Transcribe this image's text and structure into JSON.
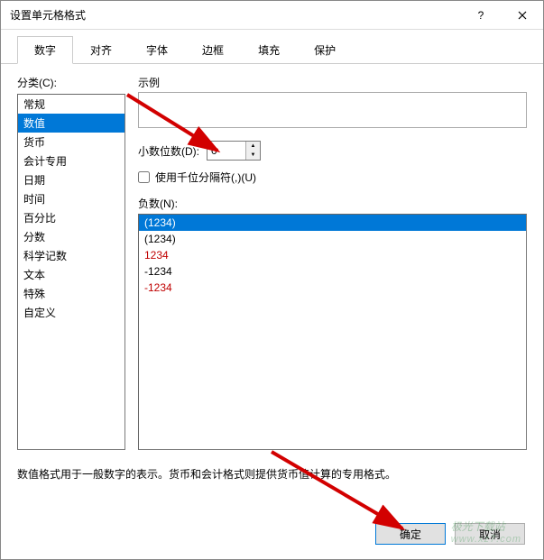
{
  "window": {
    "title": "设置单元格格式"
  },
  "tabs": [
    {
      "label": "数字",
      "active": true
    },
    {
      "label": "对齐",
      "active": false
    },
    {
      "label": "字体",
      "active": false
    },
    {
      "label": "边框",
      "active": false
    },
    {
      "label": "填充",
      "active": false
    },
    {
      "label": "保护",
      "active": false
    }
  ],
  "category": {
    "label": "分类(C):",
    "items": [
      "常规",
      "数值",
      "货币",
      "会计专用",
      "日期",
      "时间",
      "百分比",
      "分数",
      "科学记数",
      "文本",
      "特殊",
      "自定义"
    ],
    "selected_index": 1
  },
  "sample": {
    "label": "示例"
  },
  "decimals": {
    "label": "小数位数(D):",
    "value": "0"
  },
  "separator": {
    "label": "使用千位分隔符(,)(U)",
    "checked": false
  },
  "negative": {
    "label": "负数(N):",
    "items": [
      {
        "text": "(1234)",
        "red": true,
        "selected": true
      },
      {
        "text": "(1234)",
        "red": false,
        "selected": false
      },
      {
        "text": "1234",
        "red": true,
        "selected": false
      },
      {
        "text": "-1234",
        "red": false,
        "selected": false
      },
      {
        "text": "-1234",
        "red": true,
        "selected": false
      }
    ]
  },
  "description": "数值格式用于一般数字的表示。货币和会计格式则提供货币值计算的专用格式。",
  "buttons": {
    "ok": "确定",
    "cancel": "取消"
  },
  "watermark": {
    "line1": "极光下载站",
    "line2": "www.xz7.com"
  }
}
